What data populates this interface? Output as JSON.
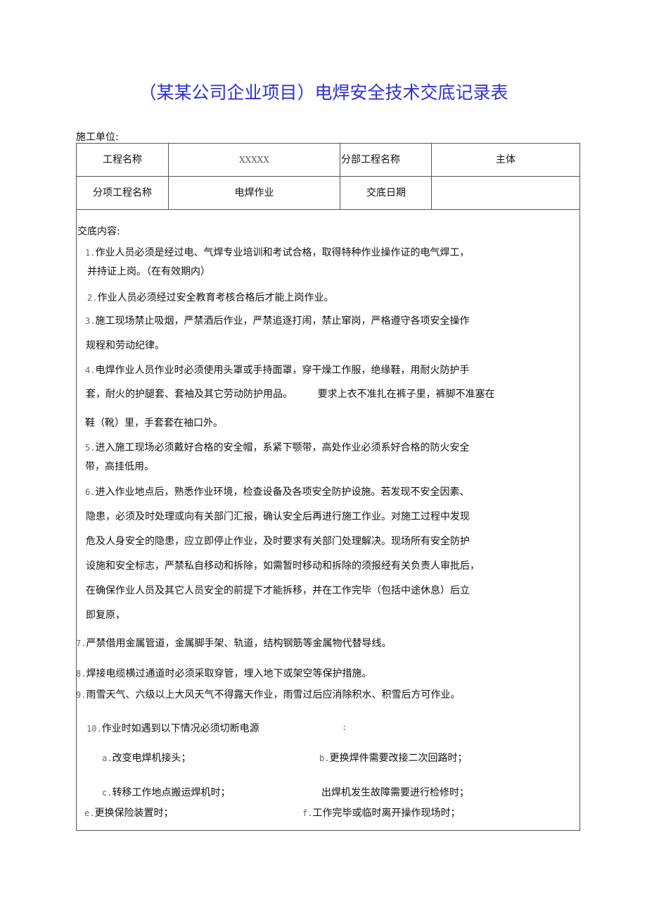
{
  "title": "（某某公司企业项目）电焊安全技术交底记录表",
  "construction_unit_label": "施工单位:",
  "header_table": {
    "row1": {
      "project_name_label": "工程名称",
      "project_name_value": "XXXXX",
      "division_label": "分部工程名称",
      "division_value": "主体"
    },
    "row2": {
      "subitem_label": "分项工程名称",
      "subitem_value": "电焊作业",
      "date_label": "交底日期",
      "date_value": ""
    }
  },
  "content": {
    "heading": "交底内容:",
    "items": [
      {
        "num": "1.",
        "lines": [
          "作业人员必须是经过电、气焊专业培训和考试合格，取得特种作业操作证的电气焊工，",
          "并持证上岗。（在有效期内）"
        ]
      },
      {
        "num": "2.",
        "lines": [
          "作业人员必须经过安全教育考核合格后才能上岗作业。"
        ]
      },
      {
        "num": "3.",
        "lines": [
          "施工现场禁止吸烟，严禁酒后作业，严禁追逐打闹，禁止窜岗，严格遵守各项安全操作",
          "规程和劳动纪律。"
        ]
      },
      {
        "num": "4.",
        "lines": [
          "电焊作业人员作业时必须使用头罩或手持面罩，穿干燥工作服，绝缘鞋，用耐火防护手",
          "套，耐火的护腿套、套袖及其它劳动防护用品。        要求上衣不准扎在裤子里，裤脚不准塞在",
          "鞋（靴）里，手套套在袖口外。"
        ]
      },
      {
        "num": "5.",
        "lines": [
          "进入施工现场必须戴好合格的安全帽，系紧下颚带，高处作业必须系好合格的防火安全",
          "带，高挂低用。"
        ]
      },
      {
        "num": "6.",
        "lines": [
          "进入作业地点后，熟悉作业环境，检查设备及各项安全防护设施。若发现不安全因素、",
          "隐患，必须及时处理或向有关部门汇报，确认安全后再进行施工作业。对施工过程中发现",
          "危及人身安全的隐患，应立即停止作业，及时要求有关部门处理解决。现场所有安全防护",
          "设施和安全标志，严禁私自移动和拆除，如需暂时移动和拆除的须报经有关负责人审批后，",
          "在确保作业人员及其它人员安全的前提下才能拆移，并在工作完毕（包括中途休息）后立",
          "即复原，"
        ]
      },
      {
        "num": "7.",
        "lines": [
          "严禁借用金属管道，金属脚手架、轨道，结构钢筋等金属物代替导线。"
        ]
      },
      {
        "num": "8.",
        "lines": [
          "焊接电缆横过通道时必须采取穿管，埋入地下或架空等保护措施。"
        ]
      },
      {
        "num": "9.",
        "lines": [
          "雨雪天气、六级以上大风天气不得露天作业，雨雪过后应消除积水、积雪后方可作业。"
        ]
      },
      {
        "num": "10.",
        "lines": [
          "作业时如遇到以下情况必须切断电源"
        ],
        "suffix": ":"
      }
    ],
    "sub_items": [
      {
        "num": "a.",
        "text": "改变电焊机接头；"
      },
      {
        "num": "b.",
        "text": "更换焊件需要改接二次回路时；"
      },
      {
        "num": "c.",
        "text": "转移工作地点搬运焊机时；"
      },
      {
        "num": "",
        "text": "出焊机发生故障需要进行检修时；"
      },
      {
        "num": "e.",
        "text": "更换保险装置时；"
      },
      {
        "num": "f.",
        "text": "工作完毕或临时离开操作现场时；"
      }
    ]
  }
}
